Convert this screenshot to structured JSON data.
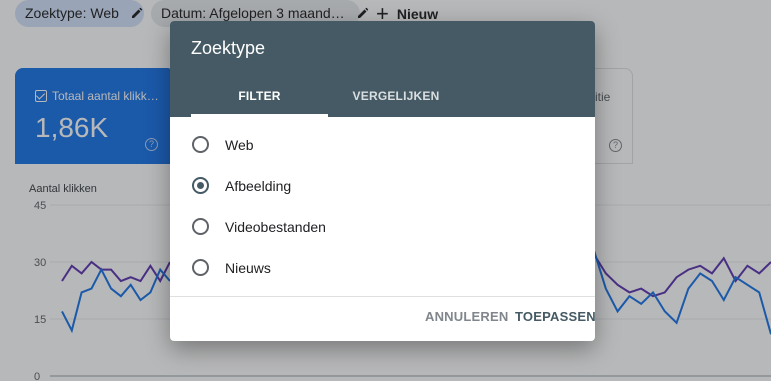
{
  "filters": {
    "type_chip": "Zoektype: Web",
    "date_chip": "Datum: Afgelopen 3 maand…",
    "new_button": "Nieuw"
  },
  "cards": {
    "clicks_label": "Totaal aantal klikk…",
    "clicks_value": "1,86K",
    "position_label_fragment": "itie",
    "help_glyph": "?"
  },
  "chart": {
    "label": "Aantal klikken",
    "ticks": [
      "45",
      "30",
      "15",
      "0"
    ]
  },
  "chart_data": {
    "type": "line",
    "ylabel": "Aantal klikken",
    "ylim": [
      0,
      45
    ],
    "series": [
      {
        "values": [
          25,
          29,
          27,
          30,
          28,
          28,
          25,
          26,
          25,
          29,
          25,
          30
        ]
      },
      {
        "values": [
          17,
          12,
          22,
          23,
          28,
          23,
          21,
          24,
          20,
          22,
          28,
          25
        ]
      }
    ],
    "series_right": [
      {
        "values": [
          32,
          27,
          24,
          22,
          23,
          21,
          22,
          26,
          28,
          29,
          27,
          31,
          25,
          29,
          27,
          30
        ]
      },
      {
        "values": [
          33,
          23,
          17,
          21,
          19,
          22,
          17,
          14,
          23,
          27,
          25,
          20,
          26,
          24,
          22,
          11
        ]
      }
    ],
    "colors": [
      "#5e35b1",
      "#1a73e8"
    ]
  },
  "dialog": {
    "title": "Zoektype",
    "tabs": [
      "FILTER",
      "VERGELIJKEN"
    ],
    "options": [
      {
        "label": "Web",
        "checked": false
      },
      {
        "label": "Afbeelding",
        "checked": true
      },
      {
        "label": "Videobestanden",
        "checked": false
      },
      {
        "label": "Nieuws",
        "checked": false
      }
    ],
    "cancel": "ANNULEREN",
    "apply": "TOEPASSEN"
  }
}
